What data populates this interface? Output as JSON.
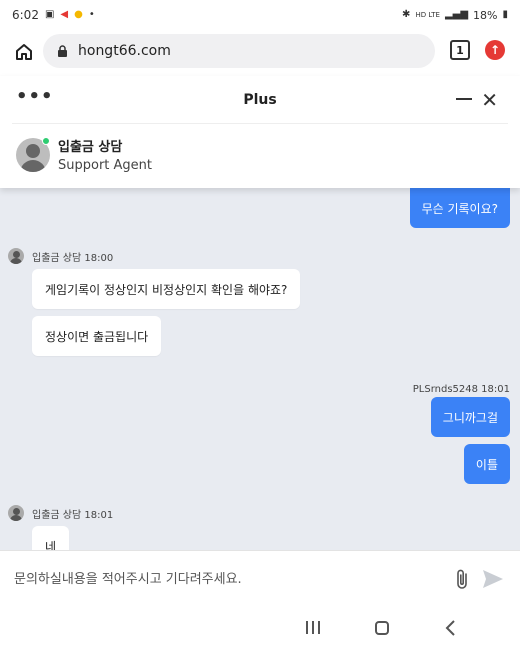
{
  "status_bar": {
    "time": "6:02",
    "battery": "18%",
    "network": "HD LTE"
  },
  "browser": {
    "url": "hongt66.com",
    "tab_count": "1"
  },
  "chat_widget": {
    "title": "Plus",
    "more_label": "•••",
    "agent_name": "입출금 상담",
    "agent_role": "Support Agent"
  },
  "messages": {
    "out_1": "무슨 기록이요?",
    "agent_meta_1": "입출금 상담 18:00",
    "in_1": "게임기록이 정상인지 비정상인지 확인을 해야죠?",
    "in_2": "정상이면 출금됩니다",
    "user_meta": "PLSrnds5248 18:01",
    "out_2": "그니까그걸",
    "out_3": "이틀",
    "agent_meta_2": "입출금 상담 18:01",
    "in_3": "네"
  },
  "composer": {
    "placeholder": "문의하실내용을 적어주시고 기다려주세요."
  },
  "colors": {
    "accent": "#3b82f6",
    "online": "#2ecc71",
    "chat_bg": "#e8ebf1",
    "alert": "#e53935"
  },
  "icons": [
    "home-icon",
    "lock-icon",
    "tab-switcher-icon",
    "browser-menu-icon",
    "more-icon",
    "minimize-icon",
    "close-icon",
    "attach-icon",
    "send-icon",
    "recent-apps-icon",
    "android-home-icon",
    "back-icon"
  ]
}
